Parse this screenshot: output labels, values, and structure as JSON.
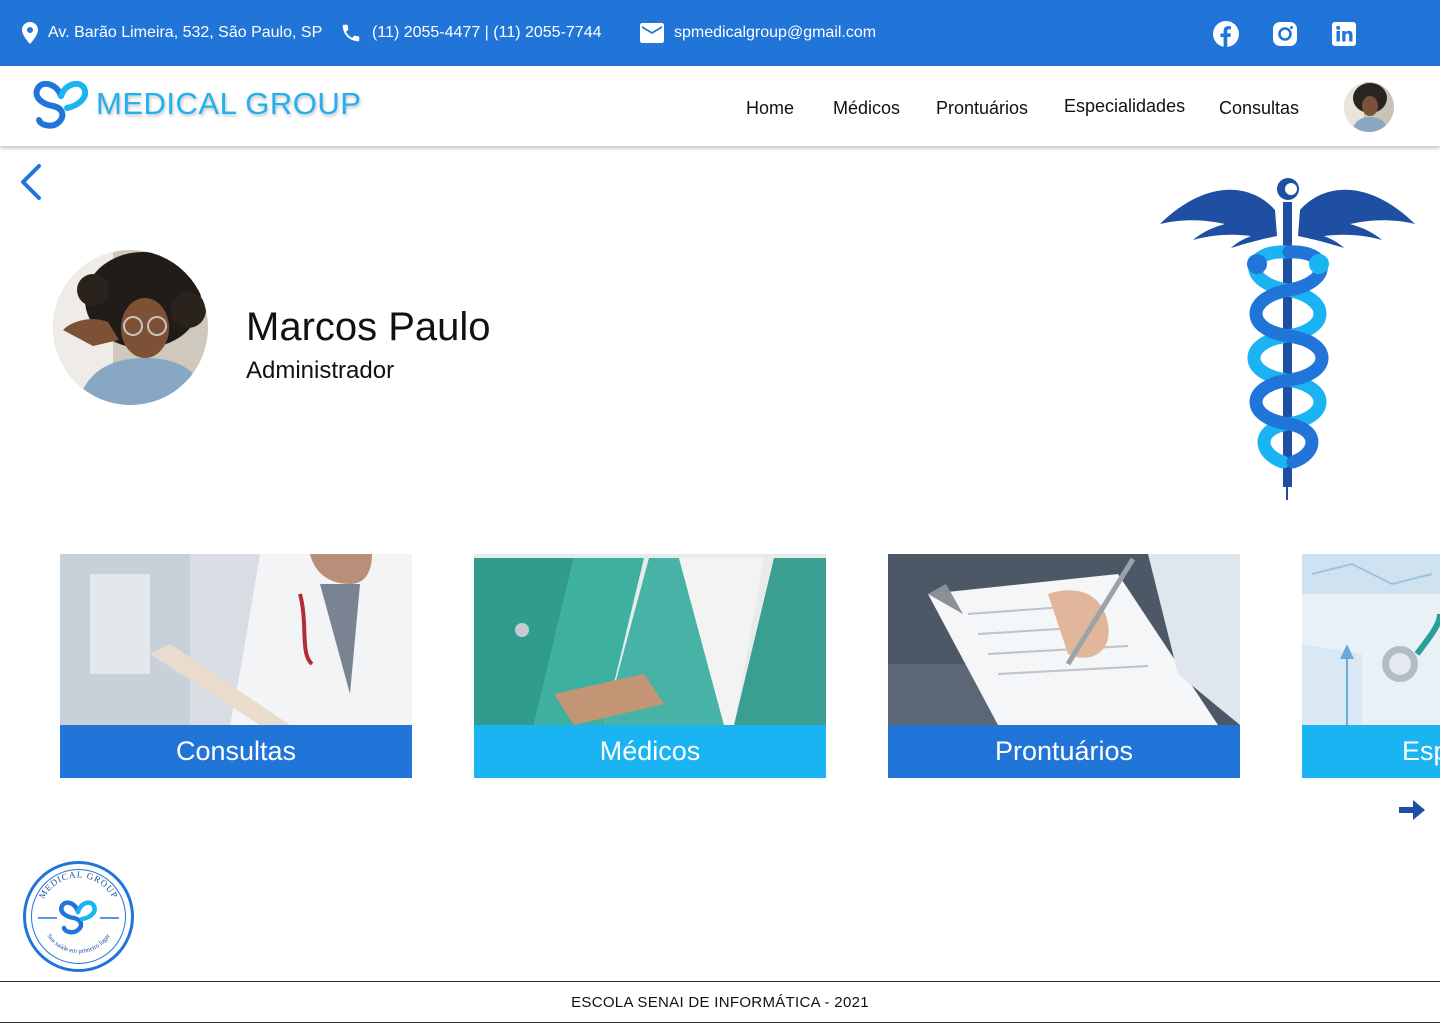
{
  "topbar": {
    "address": "Av. Barão Limeira, 532, São Paulo, SP",
    "phone": "(11) 2055-4477 | (11) 2055-7744",
    "email": "spmedicalgroup@gmail.com",
    "address_icon": "location-pin-icon",
    "phone_icon": "phone-icon",
    "email_icon": "email-icon",
    "social": [
      "facebook-icon",
      "instagram-icon",
      "linkedin-icon"
    ]
  },
  "header": {
    "brand": "MEDICAL GROUP",
    "nav": [
      "Home",
      "Médicos",
      "Prontuários",
      "Especialidades",
      "Consultas"
    ]
  },
  "profile": {
    "name": "Marcos Paulo",
    "role": "Administrador"
  },
  "cards": [
    {
      "label": "Consultas"
    },
    {
      "label": "Médicos"
    },
    {
      "label": "Prontuários"
    },
    {
      "label": "Esp"
    }
  ],
  "seal": {
    "top_text": "MEDICAL GROUP",
    "bottom_text": "Sua saúde em primeiro lugar"
  },
  "footer": {
    "text": "ESCOLA SENAI DE INFORMÁTICA - 2021"
  },
  "colors": {
    "primary": "#2175d9",
    "accent": "#1ab4f3",
    "dark_blue": "#1e4fa3"
  }
}
